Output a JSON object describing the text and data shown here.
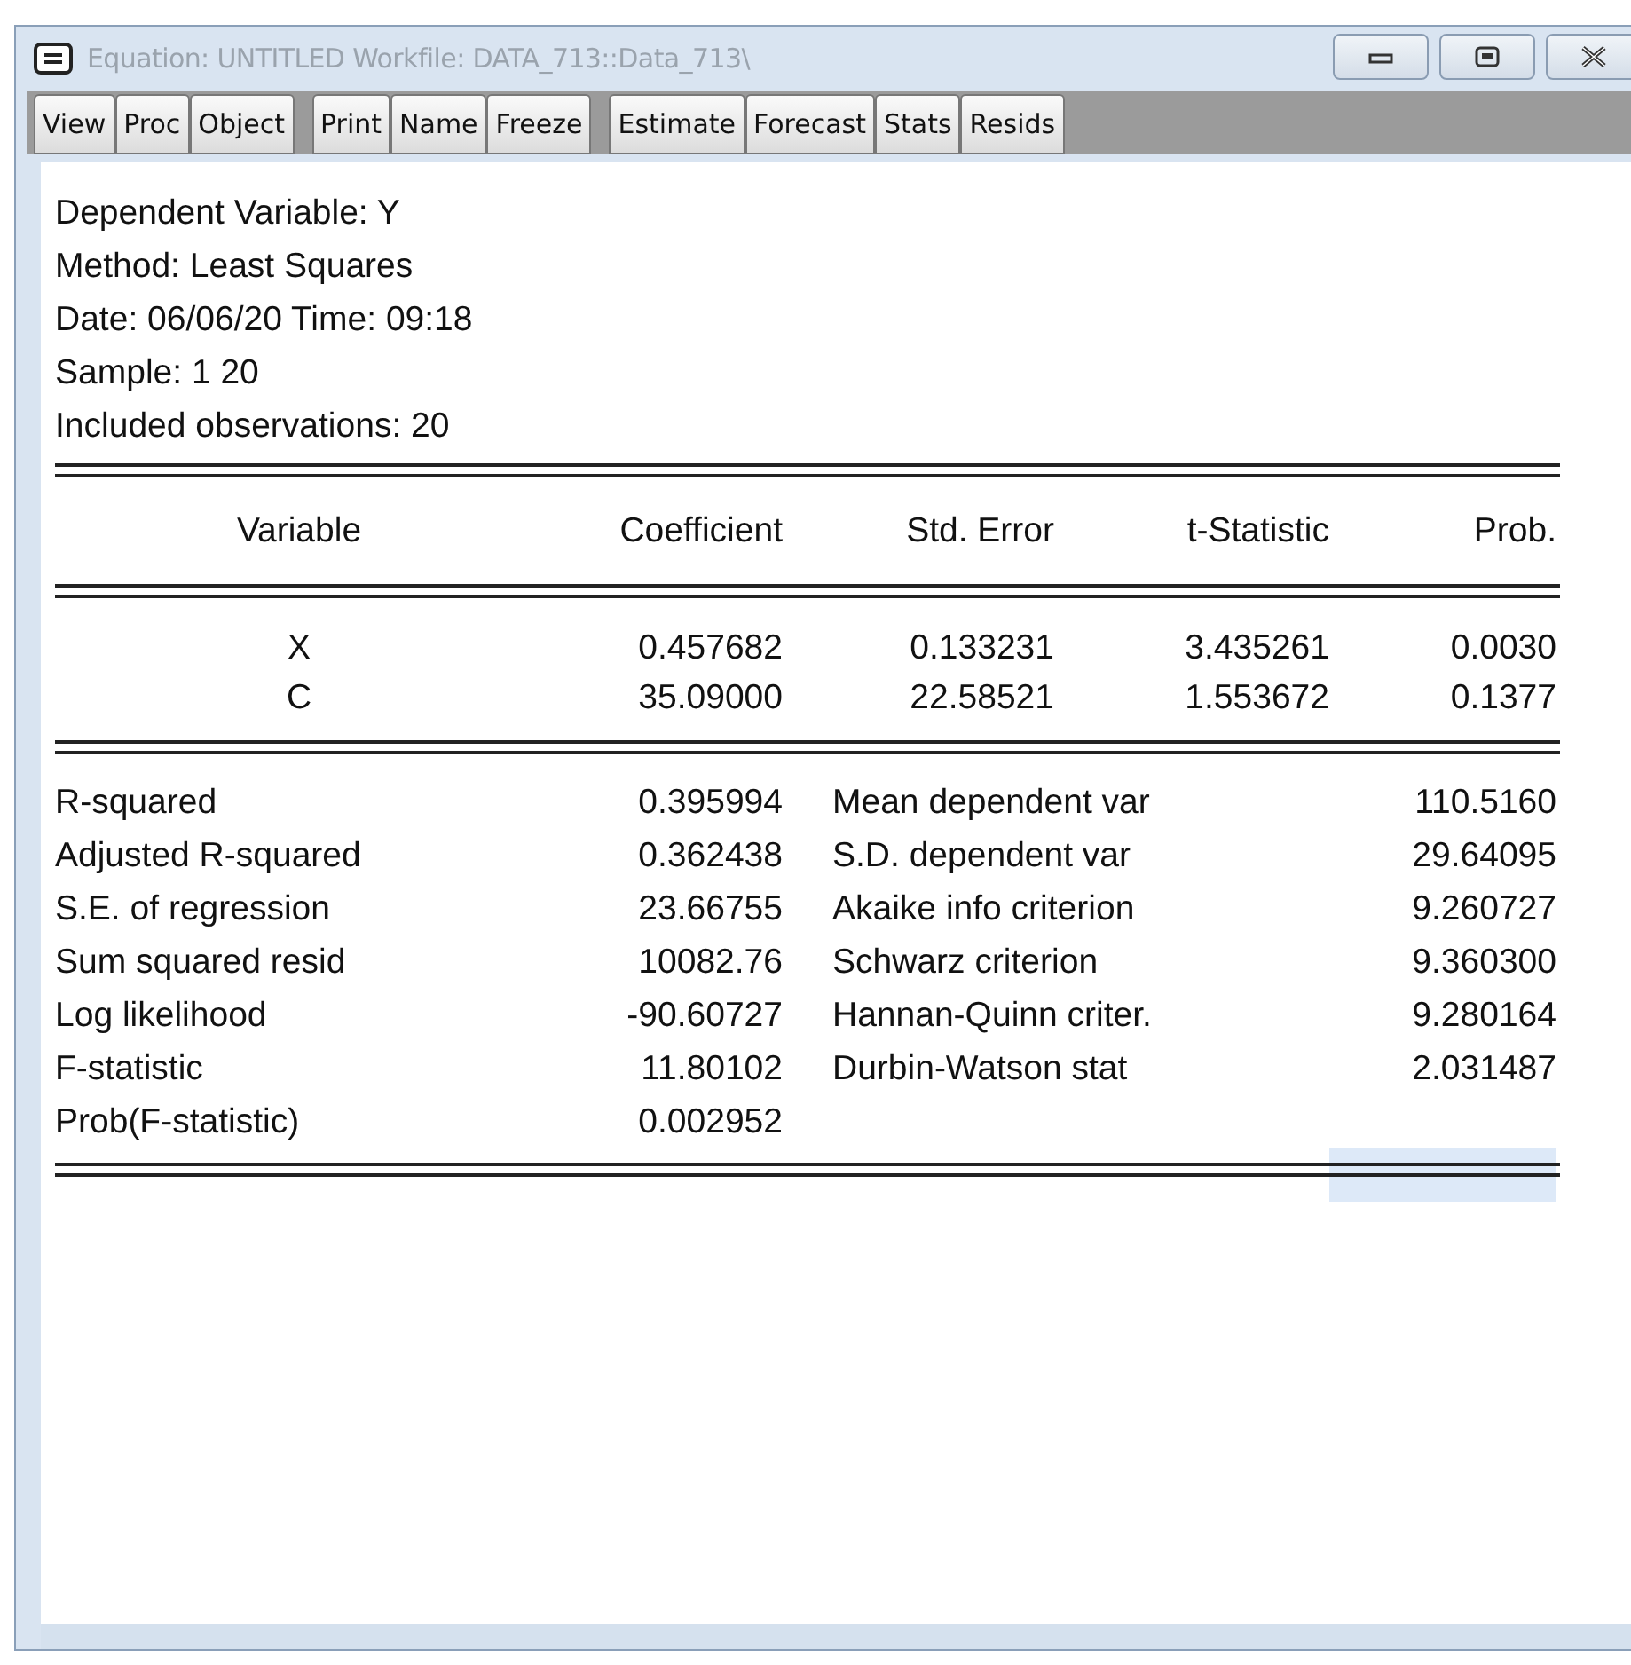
{
  "window": {
    "title": "Equation: UNTITLED   Workfile: DATA_713::Data_713\\"
  },
  "toolbar": [
    [
      "View",
      "Proc",
      "Object"
    ],
    [
      "Print",
      "Name",
      "Freeze"
    ],
    [
      "Estimate",
      "Forecast",
      "Stats",
      "Resids"
    ]
  ],
  "header_lines": [
    "Dependent Variable: Y",
    "Method: Least Squares",
    "Date: 06/06/20   Time: 09:18",
    "Sample: 1 20",
    "Included observations: 20"
  ],
  "table": {
    "columns": [
      "Variable",
      "Coefficient",
      "Std. Error",
      "t-Statistic",
      "Prob."
    ],
    "rows": [
      [
        "X",
        "0.457682",
        "0.133231",
        "3.435261",
        "0.0030"
      ],
      [
        "C",
        "35.09000",
        "22.58521",
        "1.553672",
        "0.1377"
      ]
    ]
  },
  "stats": [
    {
      "label": "R-squared",
      "value": "0.395994",
      "label_2": "Mean dependent var",
      "value_2": "110.5160"
    },
    {
      "label": "Adjusted R-squared",
      "value": "0.362438",
      "label_2": "S.D. dependent var",
      "value_2": "29.64095"
    },
    {
      "label": "S.E. of regression",
      "value": "23.66755",
      "label_2": "Akaike info criterion",
      "value_2": "9.260727"
    },
    {
      "label": "Sum squared resid",
      "value": "10082.76",
      "label_2": "Schwarz criterion",
      "value_2": "9.360300"
    },
    {
      "label": "Log likelihood",
      "value": "-90.60727",
      "label_2": "Hannan-Quinn criter.",
      "value_2": "9.280164"
    },
    {
      "label": "F-statistic",
      "value": "11.80102",
      "label_2": "Durbin-Watson stat",
      "value_2": "2.031487"
    },
    {
      "label": "Prob(F-statistic)",
      "value": "0.002952"
    }
  ],
  "selection_cell": {
    "selected": true
  }
}
